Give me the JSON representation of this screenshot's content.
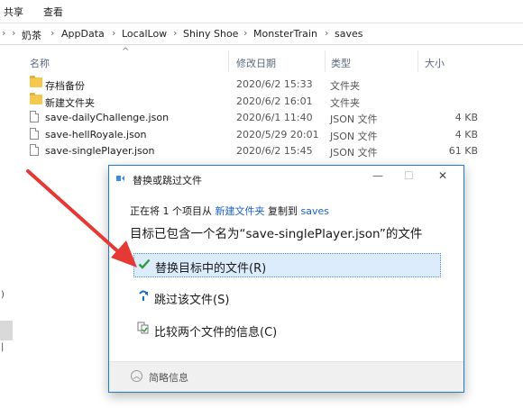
{
  "ribbon": {
    "tabs": [
      "共享",
      "查看"
    ]
  },
  "address": {
    "segments": [
      "奶茶",
      "AppData",
      "LocalLow",
      "Shiny Shoe",
      "MonsterTrain",
      "saves"
    ]
  },
  "columns": {
    "name": "名称",
    "date": "修改日期",
    "type": "类型",
    "size": "大小"
  },
  "files": [
    {
      "name": "存档备份",
      "date": "2020/6/2 15:33",
      "type": "文件夹",
      "size": ""
    },
    {
      "name": "新建文件夹",
      "date": "2020/6/2 16:01",
      "type": "文件夹",
      "size": ""
    },
    {
      "name": "save-dailyChallenge.json",
      "date": "2020/6/1 11:40",
      "type": "JSON 文件",
      "size": "4 KB"
    },
    {
      "name": "save-hellRoyale.json",
      "date": "2020/5/29 20:01",
      "type": "JSON 文件",
      "size": "4 KB"
    },
    {
      "name": "save-singlePlayer.json",
      "date": "2020/6/2 15:45",
      "type": "JSON 文件",
      "size": "61 KB"
    }
  ],
  "left_fragments": {
    "frag1": ")",
    "frag2": "|"
  },
  "dialog": {
    "title": "替换或跳过文件",
    "controls": {
      "minimize": "—",
      "maximize": "☐",
      "close": "✕"
    },
    "info": {
      "prefix": "正在将 1 个项目从 ",
      "source": "新建文件夹",
      "middle": " 复制到 ",
      "dest": "saves"
    },
    "heading": "目标已包含一个名为“save-singlePlayer.json”的文件",
    "options": {
      "replace": "替换目标中的文件(R)",
      "skip": "跳过该文件(S)",
      "compare": "比较两个文件的信息(C)"
    },
    "footer": {
      "more": "简略信息"
    }
  },
  "colors": {
    "accent": "#1f7ad6",
    "link": "#1a62c9",
    "arrow": "#e53935",
    "check": "#2e9c3a"
  }
}
